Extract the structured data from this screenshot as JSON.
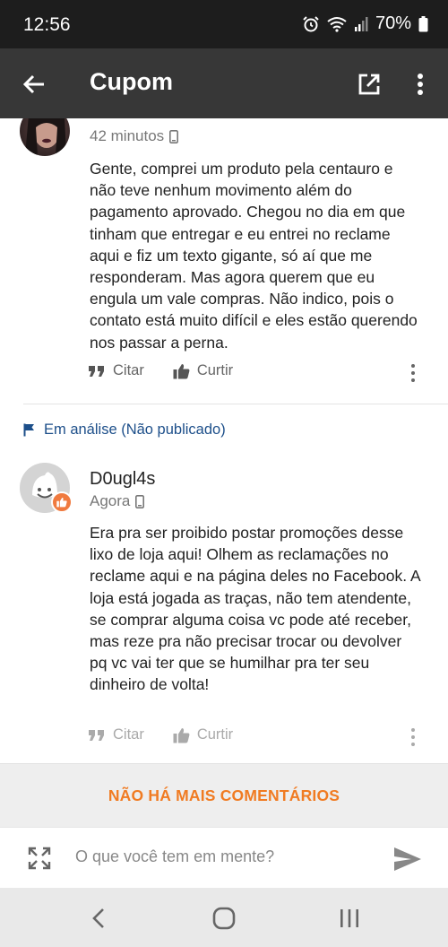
{
  "status_bar": {
    "time": "12:56",
    "battery": "70%"
  },
  "app_bar": {
    "title": "Cupom"
  },
  "comments": [
    {
      "meta_time": "42 minutos",
      "text": "Gente, comprei um produto pela centauro e não teve nenhum movimento além do pagamento aprovado. Chegou no dia em que tinham que entregar e eu entrei no reclame aqui e fiz um texto gigante, só aí que me responderam. Mas agora querem que eu engula um vale compras. Não indico, pois o contato está muito difícil e eles estão querendo nos passar a perna.",
      "quote_label": "Citar",
      "like_label": "Curtir"
    },
    {
      "review_status": "Em análise (Não publicado)",
      "author": "D0ugl4s",
      "meta_time": "Agora",
      "text": "Era pra ser proibido postar promoções desse lixo de loja aqui! Olhem as reclamações no reclame aqui e na página deles no Facebook. A loja está jogada as traças, não tem atendente, se comprar alguma coisa vc pode até receber, mas reze pra não precisar trocar ou devolver pq vc vai ter que se humilhar pra ter seu dinheiro de volta!",
      "quote_label": "Citar",
      "like_label": "Curtir"
    }
  ],
  "end_message": "NÃO HÁ MAIS COMENTÁRIOS",
  "composer": {
    "placeholder": "O que você tem em mente?"
  },
  "colors": {
    "accent": "#f07b22",
    "status_flag": "#1d4f8a",
    "app_bar": "#373737"
  }
}
